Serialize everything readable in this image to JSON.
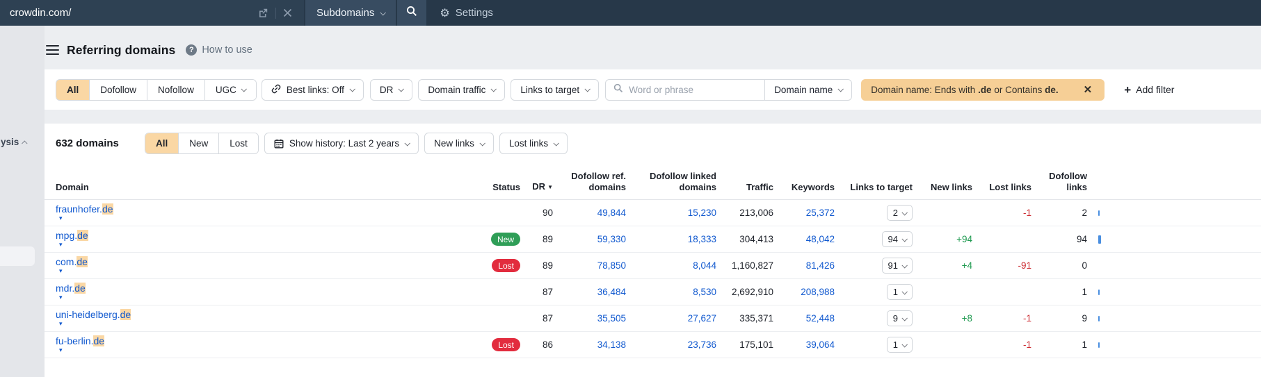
{
  "topbar": {
    "url": "crowdin.com/",
    "mode_label": "Subdomains",
    "settings_label": "Settings"
  },
  "sidebar": {
    "partial_label": "ysis"
  },
  "header": {
    "title": "Referring domains",
    "help_label": "How to use"
  },
  "filters": {
    "segments": [
      "All",
      "Dofollow",
      "Nofollow",
      "UGC"
    ],
    "selected_segment": "All",
    "best_links_label": "Best links: Off",
    "dr_label": "DR",
    "domain_traffic_label": "Domain traffic",
    "links_to_target_label": "Links to target",
    "search_placeholder": "Word or phrase",
    "search_field_label": "Domain name",
    "active_filter": {
      "text1": "Domain name: Ends with ",
      "bold1": ".de",
      "text2": " or Contains ",
      "bold2": "de."
    },
    "add_filter_label": "Add filter"
  },
  "table_controls": {
    "count": "632 domains",
    "segments": [
      "All",
      "New",
      "Lost"
    ],
    "selected_segment": "All",
    "show_history_label": "Show history: Last 2 years",
    "new_links_label": "New links",
    "lost_links_label": "Lost links"
  },
  "table": {
    "columns": [
      "Domain",
      "Status",
      "DR",
      "Dofollow ref. domains",
      "Dofollow linked domains",
      "Traffic",
      "Keywords",
      "Links to target",
      "New links",
      "Lost links",
      "Dofollow links"
    ],
    "rows": [
      {
        "domain": "fraunhofer.de",
        "highlight": "de",
        "status": "",
        "dr": "90",
        "dofollow_ref": "49,844",
        "dofollow_linked": "15,230",
        "traffic": "213,006",
        "keywords": "25,372",
        "links_to_target": "2",
        "new_links": "",
        "lost_links": "-1",
        "dofollow_links": "2",
        "bar": 2
      },
      {
        "domain": "mpg.de",
        "highlight": "de",
        "status": "New",
        "dr": "89",
        "dofollow_ref": "59,330",
        "dofollow_linked": "18,333",
        "traffic": "304,413",
        "keywords": "48,042",
        "links_to_target": "94",
        "new_links": "+94",
        "lost_links": "",
        "dofollow_links": "94",
        "bar": 94
      },
      {
        "domain": "com.de",
        "highlight": "de",
        "status": "Lost",
        "dr": "89",
        "dofollow_ref": "78,850",
        "dofollow_linked": "8,044",
        "traffic": "1,160,827",
        "keywords": "81,426",
        "links_to_target": "91",
        "new_links": "+4",
        "lost_links": "-91",
        "dofollow_links": "0",
        "bar": 0
      },
      {
        "domain": "mdr.de",
        "highlight": "de",
        "status": "",
        "dr": "87",
        "dofollow_ref": "36,484",
        "dofollow_linked": "8,530",
        "traffic": "2,692,910",
        "keywords": "208,988",
        "links_to_target": "1",
        "new_links": "",
        "lost_links": "",
        "dofollow_links": "1",
        "bar": 1
      },
      {
        "domain": "uni-heidelberg.de",
        "highlight": "de",
        "status": "",
        "dr": "87",
        "dofollow_ref": "35,505",
        "dofollow_linked": "27,627",
        "traffic": "335,371",
        "keywords": "52,448",
        "links_to_target": "9",
        "new_links": "+8",
        "lost_links": "-1",
        "dofollow_links": "9",
        "bar": 9
      },
      {
        "domain": "fu-berlin.de",
        "highlight": "de",
        "status": "Lost",
        "dr": "86",
        "dofollow_ref": "34,138",
        "dofollow_linked": "23,736",
        "traffic": "175,101",
        "keywords": "39,064",
        "links_to_target": "1",
        "new_links": "",
        "lost_links": "-1",
        "dofollow_links": "1",
        "bar": 1
      }
    ]
  },
  "colors": {
    "topbar_bg": "#273849",
    "accent_peach": "#fad7a4",
    "chip_bg": "#f6cf96",
    "link_blue": "#1159cf",
    "positive_green": "#1f9a50",
    "negative_red": "#cc2b31",
    "badge_new": "#2f9e57",
    "badge_lost": "#e22c3e"
  }
}
